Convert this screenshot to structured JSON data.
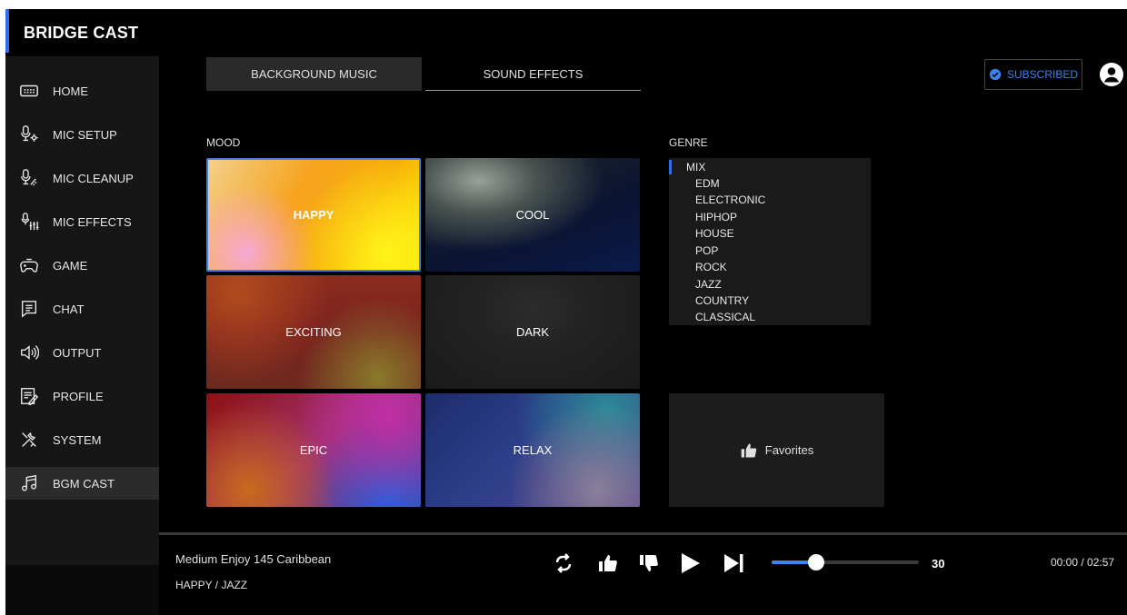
{
  "app": {
    "title": "BRIDGE CAST"
  },
  "sidebar": {
    "items": [
      {
        "label": "HOME",
        "icon": "keyboard-icon"
      },
      {
        "label": "MIC SETUP",
        "icon": "mic-settings-icon"
      },
      {
        "label": "MIC CLEANUP",
        "icon": "mic-cleanup-icon"
      },
      {
        "label": "MIC EFFECTS",
        "icon": "mic-effects-icon"
      },
      {
        "label": "GAME",
        "icon": "gamepad-icon"
      },
      {
        "label": "CHAT",
        "icon": "chat-icon"
      },
      {
        "label": "OUTPUT",
        "icon": "speaker-icon"
      },
      {
        "label": "PROFILE",
        "icon": "profile-icon"
      },
      {
        "label": "SYSTEM",
        "icon": "tools-icon"
      },
      {
        "label": "BGM CAST",
        "icon": "music-note-icon",
        "active": true
      }
    ]
  },
  "tabs": [
    {
      "label": "BACKGROUND MUSIC",
      "active": true
    },
    {
      "label": "SOUND EFFECTS",
      "active": false
    }
  ],
  "header": {
    "subscribed_label": "SUBSCRIBED"
  },
  "mood": {
    "label": "MOOD",
    "tiles": [
      "HAPPY",
      "COOL",
      "EXCITING",
      "DARK",
      "EPIC",
      "RELAX"
    ],
    "selected": "HAPPY"
  },
  "genre": {
    "label": "GENRE",
    "items": [
      "MIX",
      "EDM",
      "ELECTRONIC",
      "HIPHOP",
      "HOUSE",
      "POP",
      "ROCK",
      "JAZZ",
      "COUNTRY",
      "CLASSICAL"
    ],
    "selected": "MIX"
  },
  "favorites": {
    "label": "Favorites"
  },
  "player": {
    "title": "Medium Enjoy 145 Caribbean",
    "subtitle": "HAPPY / JAZZ",
    "volume": 30,
    "volume_display": "30",
    "volume_fraction": 0.3,
    "time": "00:00 / 02:57"
  },
  "colors": {
    "accent": "#2f6ee6",
    "background": "#000000",
    "sidebar": "#161616",
    "subscribed": "#3b82f6"
  }
}
